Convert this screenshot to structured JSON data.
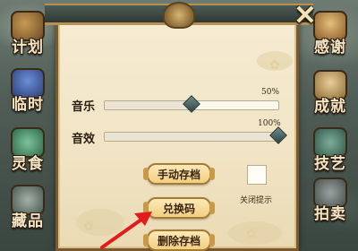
{
  "left_menu": [
    {
      "label": "计划",
      "icon": "plan-scroll-icon"
    },
    {
      "label": "临时",
      "icon": "pouch-icon"
    },
    {
      "label": "灵食",
      "icon": "food-bowl-icon"
    },
    {
      "label": "藏品",
      "icon": "cauldron-icon"
    }
  ],
  "right_menu": [
    {
      "label": "感谢",
      "icon": "praying-hands-icon"
    },
    {
      "label": "成就",
      "icon": "trophy-scroll-icon"
    },
    {
      "label": "技艺",
      "icon": "teapot-icon"
    },
    {
      "label": "拍卖",
      "icon": "scales-icon"
    }
  ],
  "settings": {
    "music_label": "音乐",
    "music_value_text": "50%",
    "music_value": 0.5,
    "sfx_label": "音效",
    "sfx_value_text": "100%",
    "sfx_value": 1.0
  },
  "buttons": {
    "manual_save": "手动存档",
    "redeem_code": "兑换码",
    "delete_save": "删除存档"
  },
  "toggle": {
    "label": "关闭提示",
    "checked": false
  },
  "colors": {
    "panel_bg": "#f1e4c4",
    "panel_border": "#7a5a2c",
    "button_bg": "#f1cf82",
    "knob": "#2f4547",
    "arrow": "#e21b1b"
  }
}
